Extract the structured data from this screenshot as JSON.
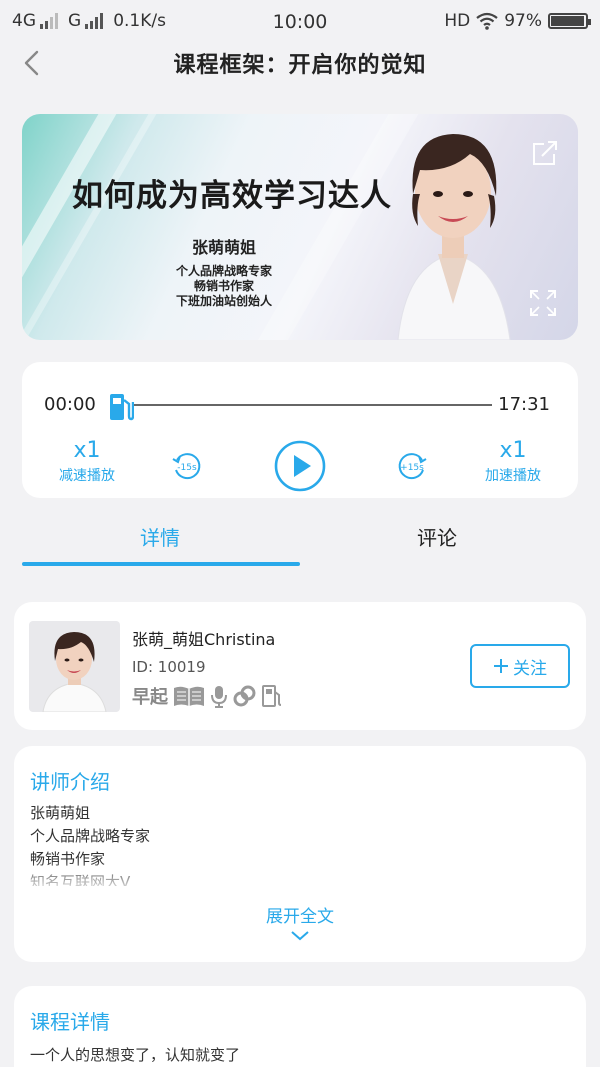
{
  "status_bar": {
    "net1": "4G",
    "net2": "G",
    "speed": "0.1K/s",
    "time": "10:00",
    "hd": "HD",
    "battery": "97%",
    "battery_level": 0.97
  },
  "nav": {
    "title": "课程框架：开启你的觉知",
    "back_icon": "chevron-left-icon"
  },
  "banner": {
    "headline": "如何成为高效学习达人",
    "author_name": "张萌萌姐",
    "author_titles": [
      "个人品牌战略专家",
      "畅销书作家",
      "下班加油站创始人"
    ],
    "share_icon": "share-icon",
    "fullscreen_icon": "fullscreen-icon"
  },
  "player": {
    "current_time": "00:00",
    "total_time": "17:31",
    "progress": 0,
    "slow": {
      "value": "x1",
      "label": "减速播放"
    },
    "fast": {
      "value": "x1",
      "label": "加速播放"
    },
    "rewind_label": "-15s",
    "forward_label": "+15s",
    "accent": "#29a9ea"
  },
  "tabs": [
    {
      "label": "详情",
      "active": true
    },
    {
      "label": "评论",
      "active": false
    }
  ],
  "teacher": {
    "name": "张萌_萌姐Christina",
    "id": "ID: 10019",
    "badge_text": "早起",
    "badge_icons": [
      "book-icon",
      "microphone-icon",
      "rings-icon",
      "fuel-icon"
    ],
    "follow_label": "关注",
    "follow_icon": "plus-icon"
  },
  "intro": {
    "title": "讲师介绍",
    "lines": [
      "张萌萌姐",
      "个人品牌战略专家",
      "畅销书作家",
      "知名互联网大V"
    ],
    "expand_label": "展开全文"
  },
  "detail": {
    "title": "课程详情",
    "text": "一个人的思想变了，认知就变了"
  }
}
